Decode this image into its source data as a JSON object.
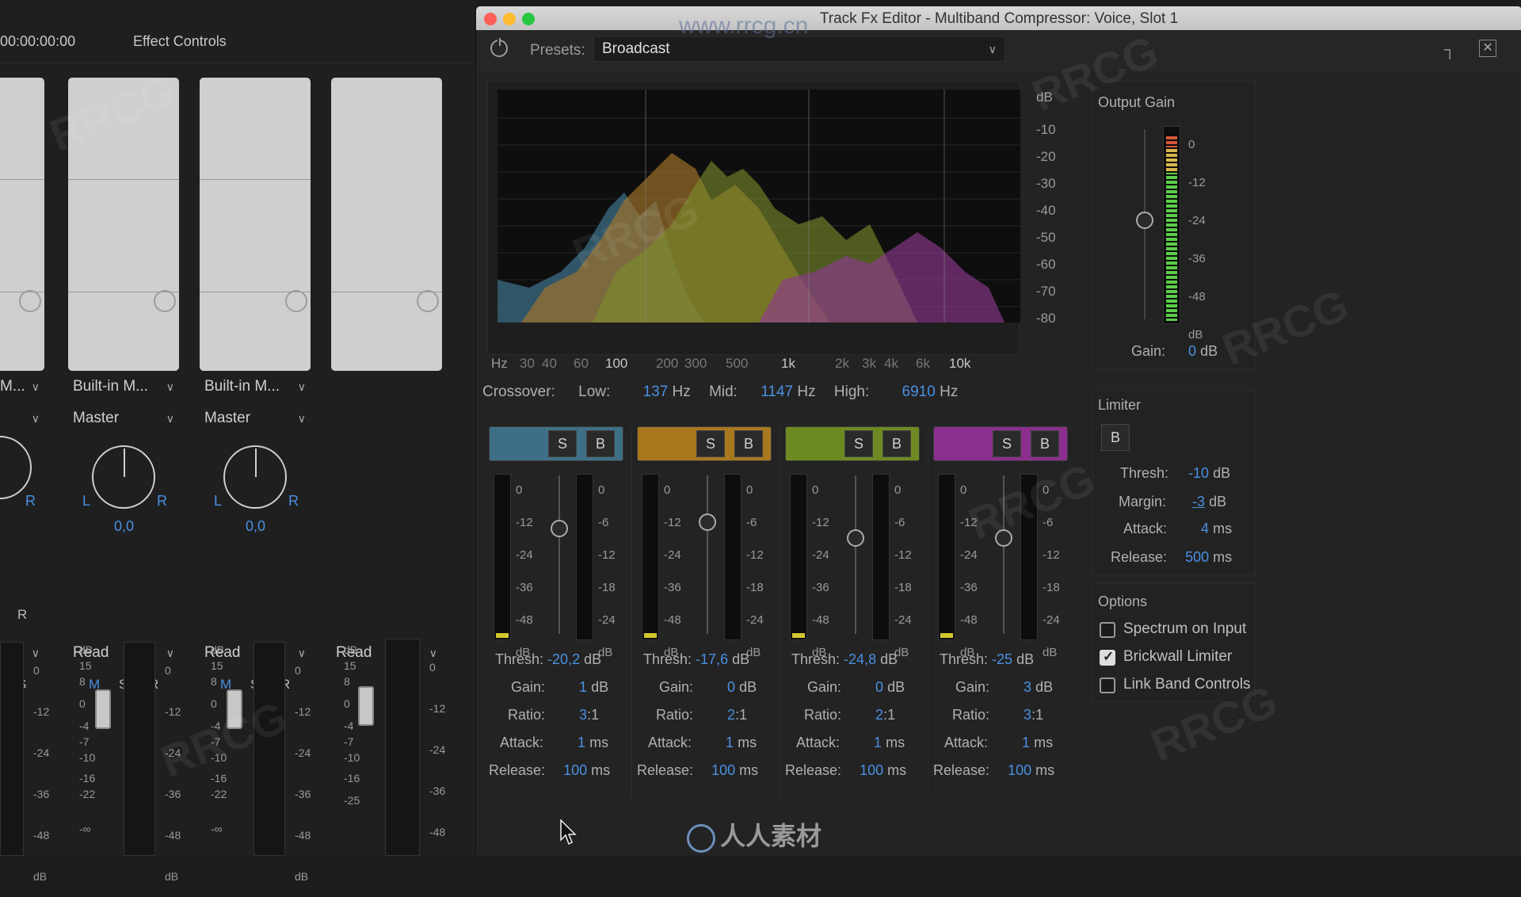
{
  "mixer": {
    "timecode": "00:00:00:00",
    "effect_controls": "Effect Controls",
    "channels": [
      {
        "input": "M...",
        "output": "",
        "pan": "",
        "automation": "",
        "buttons": [
          "S",
          "R"
        ]
      },
      {
        "input": "Built-in M...",
        "output": "Master",
        "pan": "0,0",
        "automation": "Read",
        "buttons": [
          "M",
          "S",
          "R"
        ]
      },
      {
        "input": "Built-in M...",
        "output": "Master",
        "pan": "0,0",
        "automation": "Read",
        "buttons": [
          "M",
          "S",
          "R"
        ]
      },
      {
        "input": "",
        "output": "",
        "pan": "",
        "automation": "Read",
        "buttons": []
      }
    ],
    "pan_l": "L",
    "pan_r": "R",
    "fader_scale": [
      "dB",
      "15",
      "8",
      "0",
      "-4",
      "-7",
      "-10",
      "-16",
      "-22",
      "-∞"
    ],
    "fader_scale_alt": [
      "dB",
      "15",
      "8",
      "0",
      "-4",
      "-7",
      "-10",
      "-16",
      "-25"
    ],
    "meter_scale": [
      "0",
      "-12",
      "-24",
      "-36",
      "-48",
      "dB"
    ]
  },
  "editor": {
    "window_title": "Track Fx Editor - Multiband Compressor: Voice, Slot 1",
    "presets_label": "Presets:",
    "preset_value": "Broadcast",
    "spectrum": {
      "db_unit": "dB",
      "db_ticks": [
        "-10",
        "-20",
        "-30",
        "-40",
        "-50",
        "-60",
        "-70",
        "-80"
      ],
      "hz_unit": "Hz",
      "hz_ticks": [
        "30",
        "40",
        "60",
        "100",
        "200",
        "300",
        "500",
        "1k",
        "2k",
        "3k",
        "4k",
        "6k",
        "10k"
      ]
    },
    "crossover": {
      "label": "Crossover:",
      "low_label": "Low:",
      "low": "137",
      "mid_label": "Mid:",
      "mid": "1147",
      "high_label": "High:",
      "high": "6910",
      "unit": "Hz"
    },
    "output_gain": {
      "label": "Output Gain",
      "scale": [
        "0",
        "-12",
        "-24",
        "-36",
        "-48",
        "dB"
      ],
      "gain_label": "Gain:",
      "gain_value": "0",
      "gain_unit": "dB"
    },
    "bands": [
      {
        "color": "#3f6f86",
        "solo": "S",
        "bypass": "B",
        "thresh": "-20,2",
        "gain": "1",
        "ratio": "3",
        "attack": "1",
        "release": "100"
      },
      {
        "color": "#a8781f",
        "solo": "S",
        "bypass": "B",
        "thresh": "-17,6",
        "gain": "0",
        "ratio": "2",
        "attack": "1",
        "release": "100"
      },
      {
        "color": "#6d8a22",
        "solo": "S",
        "bypass": "B",
        "thresh": "-24,8",
        "gain": "0",
        "ratio": "2",
        "attack": "1",
        "release": "100"
      },
      {
        "color": "#8b2f8e",
        "solo": "S",
        "bypass": "B",
        "thresh": "-25",
        "gain": "3",
        "ratio": "3",
        "attack": "1",
        "release": "100"
      }
    ],
    "band_labels": {
      "thresh": "Thresh:",
      "gain": "Gain:",
      "ratio": "Ratio:",
      "attack": "Attack:",
      "release": "Release:",
      "db": "dB",
      "ms": "ms",
      "ratio_suffix": ":1"
    },
    "band_scale_left": [
      "0",
      "-12",
      "-24",
      "-36",
      "-48",
      "dB"
    ],
    "band_scale_right": [
      "0",
      "-6",
      "-12",
      "-18",
      "-24",
      "dB"
    ],
    "limiter": {
      "label": "Limiter",
      "bypass": "B",
      "thresh_label": "Thresh:",
      "thresh": "-10",
      "thresh_unit": "dB",
      "margin_label": "Margin:",
      "margin": "-3",
      "margin_unit": "dB",
      "attack_label": "Attack:",
      "attack": "4",
      "attack_unit": "ms",
      "release_label": "Release:",
      "release": "500",
      "release_unit": "ms"
    },
    "options": {
      "label": "Options",
      "items": [
        {
          "label": "Spectrum on Input",
          "checked": false
        },
        {
          "label": "Brickwall Limiter",
          "checked": true
        },
        {
          "label": "Link Band Controls",
          "checked": false
        }
      ]
    },
    "watermark_text": "www.rrcg.cn",
    "brand_text": "人人素材"
  }
}
